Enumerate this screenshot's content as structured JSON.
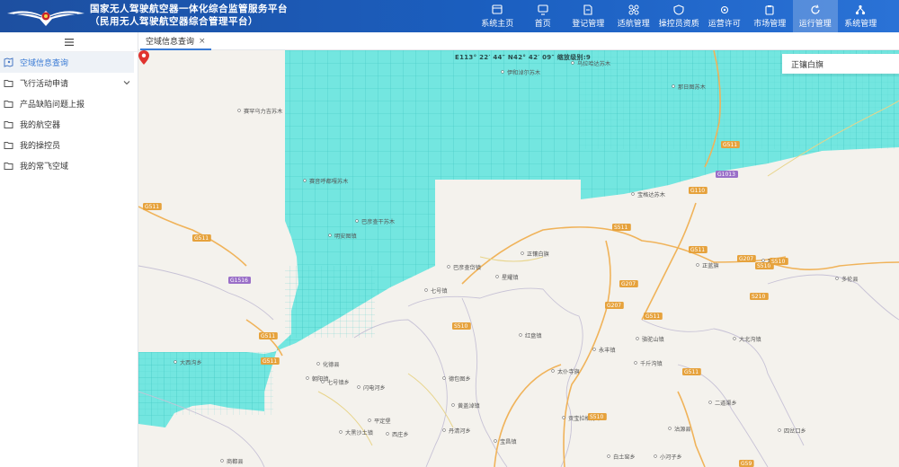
{
  "header": {
    "title_line1": "国家无人驾驶航空器一体化综合监管服务平台",
    "title_line2": "（民用无人驾驶航空器综合管理平台）",
    "nav": [
      {
        "label": "系统主页",
        "icon": "window-icon",
        "active": false
      },
      {
        "label": "首页",
        "icon": "monitor-icon",
        "active": false
      },
      {
        "label": "登记管理",
        "icon": "document-icon",
        "active": false
      },
      {
        "label": "适航管理",
        "icon": "drone-icon",
        "active": false
      },
      {
        "label": "操控员资质",
        "icon": "shield-icon",
        "active": false
      },
      {
        "label": "运营许可",
        "icon": "gear-icon",
        "active": false
      },
      {
        "label": "市场管理",
        "icon": "clipboard-icon",
        "active": false
      },
      {
        "label": "运行管理",
        "icon": "refresh-icon",
        "active": true
      },
      {
        "label": "系统管理",
        "icon": "network-icon",
        "active": false
      }
    ]
  },
  "sidebar": {
    "items": [
      {
        "label": "空域信息查询",
        "icon": "map-icon",
        "active": true
      },
      {
        "label": "飞行活动申请",
        "icon": "folder-icon",
        "active": false,
        "expandable": true
      },
      {
        "label": "产品缺陷问题上报",
        "icon": "folder-icon",
        "active": false
      },
      {
        "label": "我的航空器",
        "icon": "folder-icon",
        "active": false
      },
      {
        "label": "我的操控员",
        "icon": "folder-icon",
        "active": false
      },
      {
        "label": "我的常飞空域",
        "icon": "folder-icon",
        "active": false
      }
    ]
  },
  "tabs": [
    {
      "label": "空域信息查询",
      "close": "×"
    }
  ],
  "map": {
    "coord_readout": "E113° 22′ 44″  N42° 42′ 09″  缩放级别:9",
    "region_box": "正镶白旗",
    "zone_color": "#6ee9e4",
    "places": [
      {
        "name": "伊和淖尔苏木"
      },
      {
        "name": "乌拉哈达苏木"
      },
      {
        "name": "那日图苏木"
      },
      {
        "name": "赛罕乌力吉苏木"
      },
      {
        "name": "赛音呼都嘎苏木"
      },
      {
        "name": "巴彦查干苏木"
      },
      {
        "name": "宝格达苏木"
      },
      {
        "name": "巴彦查岱镇"
      },
      {
        "name": "正镶白旗"
      },
      {
        "name": "星耀镇"
      },
      {
        "name": "明安图镇"
      },
      {
        "name": "七号镇"
      },
      {
        "name": "正蓝旗"
      },
      {
        "name": "那日图"
      },
      {
        "name": "多伦县"
      },
      {
        "name": "红盘镇"
      },
      {
        "name": "太仆寺旗"
      },
      {
        "name": "永丰镇"
      },
      {
        "name": "骆驼山镇"
      },
      {
        "name": "千斤沟镇"
      },
      {
        "name": "大北沟镇"
      },
      {
        "name": "化德县"
      },
      {
        "name": "朝阳镇"
      },
      {
        "name": "大西沟乡"
      },
      {
        "name": "七号镇乡"
      },
      {
        "name": "德包图乡"
      },
      {
        "name": "贡宝拉格苏木"
      },
      {
        "name": "沽源县"
      },
      {
        "name": "丰宁"
      },
      {
        "name": "闪电河乡"
      },
      {
        "name": "黄盖淖镇"
      },
      {
        "name": "九连城镇"
      },
      {
        "name": "宝昌镇"
      },
      {
        "name": "四岔口乡"
      },
      {
        "name": "平定堡"
      },
      {
        "name": "白土窑乡"
      },
      {
        "name": "商都县"
      },
      {
        "name": "二道渠乡"
      },
      {
        "name": "小河子乡"
      },
      {
        "name": "丹清河乡"
      },
      {
        "name": "西庄乡"
      },
      {
        "name": "大黑沙土镇"
      }
    ],
    "road_labels": [
      "G511",
      "G511",
      "G1516",
      "G511",
      "G511",
      "G207",
      "G511",
      "S510",
      "G511",
      "G207",
      "S510",
      "S510",
      "G110",
      "G1013",
      "S511",
      "G511",
      "G207",
      "G511",
      "S510",
      "S210",
      "G59"
    ]
  }
}
